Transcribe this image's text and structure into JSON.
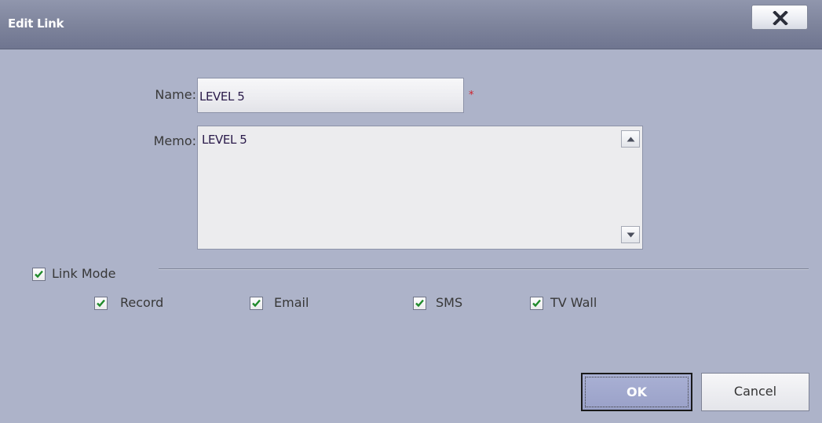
{
  "dialog": {
    "title": "Edit Link",
    "close_icon": "close-x-icon"
  },
  "form": {
    "name_label": "Name:",
    "name_value": "LEVEL 5",
    "required_marker": "*",
    "memo_label": "Memo:",
    "memo_value": "LEVEL 5"
  },
  "link_mode": {
    "label": "Link Mode",
    "checked": true,
    "options": [
      {
        "label": "Record",
        "checked": true
      },
      {
        "label": "Email",
        "checked": true
      },
      {
        "label": "SMS",
        "checked": true
      },
      {
        "label": "TV Wall",
        "checked": true
      }
    ]
  },
  "buttons": {
    "ok": "OK",
    "cancel": "Cancel"
  },
  "colors": {
    "accent_check": "#1f8a2a",
    "required": "#d0202a",
    "title_bar": "#7d839b"
  }
}
